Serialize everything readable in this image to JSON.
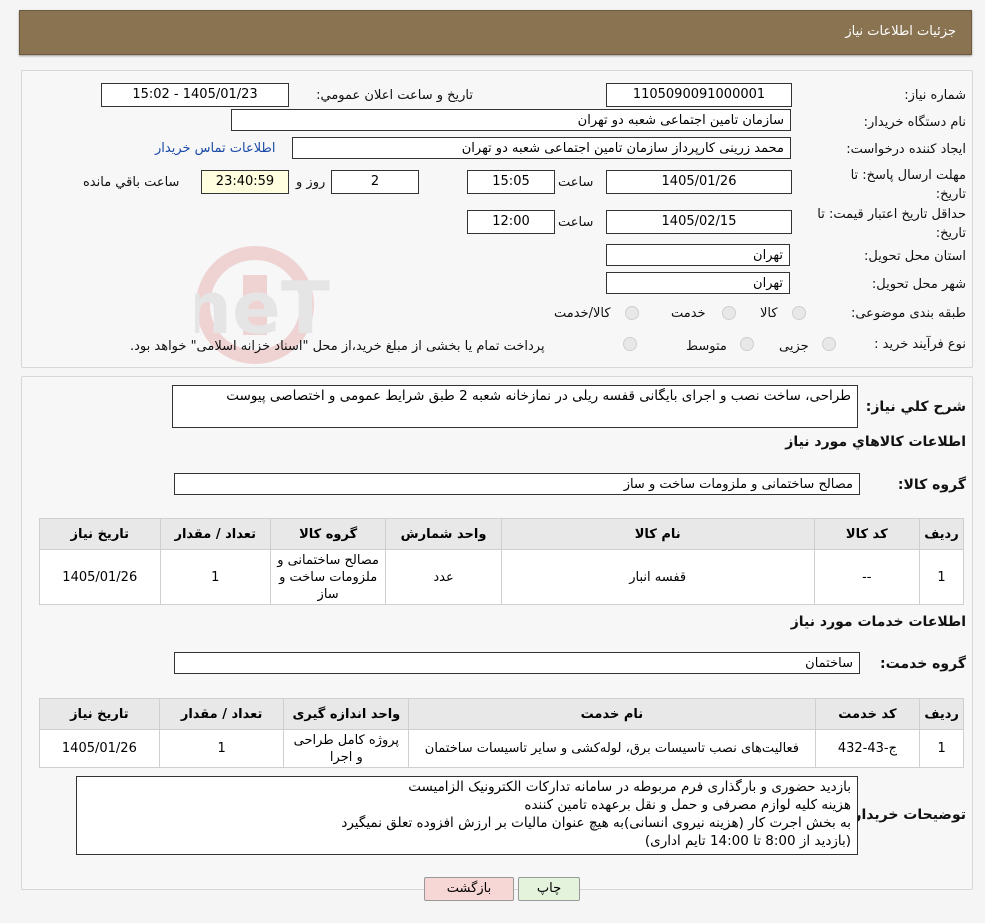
{
  "header": {
    "title": "جزئیات اطلاعات نیاز"
  },
  "info": {
    "need_number_label": "شماره نیاز:",
    "need_number": "1105090091000001",
    "announce_label": "تاریخ و ساعت اعلان عمومي:",
    "announce_value": "1405/01/23 - 15:02",
    "buyer_org_label": "نام دستگاه خریدار:",
    "buyer_org": "سازمان تامین اجتماعی شعبه دو تهران",
    "creator_label": "ایجاد کننده درخواست:",
    "creator": "محمد زرینی کارپرداز سازمان تامین اجتماعی شعبه دو تهران",
    "contact_link": "اطلاعات تماس خریدار",
    "deadline_label": "مهلت ارسال پاسخ: تا تاریخ:",
    "deadline_date": "1405/01/26",
    "time_label": "ساعت",
    "deadline_time": "15:05",
    "days_count": "2",
    "days_label": "روز و",
    "remaining_time": "23:40:59",
    "remaining_label": "ساعت باقي مانده",
    "validity_label": "حداقل تاریخ اعتبار قیمت: تا تاریخ:",
    "validity_date": "1405/02/15",
    "validity_time": "12:00",
    "province_label": "استان محل تحویل:",
    "province": "تهران",
    "city_label": "شهر محل تحویل:",
    "city": "تهران",
    "category_label": "طبقه بندی موضوعی:",
    "cat_options": [
      "کالا",
      "خدمت",
      "کالا/خدمت"
    ],
    "process_label": "نوع فرآیند خرید :",
    "process_options": [
      "جزیی",
      "متوسط"
    ],
    "process_note": "پرداخت تمام یا بخشی از مبلغ خرید،از محل \"اسناد خزانه اسلامی\" خواهد بود."
  },
  "summary": {
    "label": "شرح کلي نیاز:",
    "text": "طراحی، ساخت نصب و اجرای بایگانی قفسه ریلی در نمازخانه شعبه 2 طبق شرایط عمومی و اختصاصی پیوست",
    "goods_title": "اطلاعات کالاهاي مورد نیاز",
    "goods_group_label": "گروه کالا:",
    "goods_group": "مصالح ساختمانی و ملزومات ساخت و ساز"
  },
  "goods_table": {
    "headers": [
      "ردیف",
      "کد کالا",
      "نام کالا",
      "واحد شمارش",
      "گروه کالا",
      "تعداد / مقدار",
      "تاریخ نیاز"
    ],
    "rows": [
      [
        "1",
        "--",
        "قفسه انبار",
        "عدد",
        "مصالح ساختمانی و ملزومات ساخت و ساز",
        "1",
        "1405/01/26"
      ]
    ]
  },
  "services": {
    "title": "اطلاعات خدمات مورد نیاز",
    "group_label": "گروه خدمت:",
    "group": "ساختمان"
  },
  "services_table": {
    "headers": [
      "ردیف",
      "کد خدمت",
      "نام خدمت",
      "واحد اندازه گیری",
      "تعداد / مقدار",
      "تاریخ نیاز"
    ],
    "rows": [
      [
        "1",
        "ج-43-432",
        "فعالیت‌های نصب تاسیسات برق، لوله‌کشی و سایر تاسیسات ساختمان",
        "پروژه کامل طراحی و اجرا",
        "1",
        "1405/01/26"
      ]
    ]
  },
  "buyer_notes": {
    "label": "توضیحات خریدار:",
    "lines": [
      "بازدید حضوری و بارگذاری فرم مربوطه در سامانه تدارکات الکترونیک الزامیست",
      "هزینه کلیه لوازم مصرفی و حمل و نقل برعهده تامین کننده",
      "به بخش اجرت کار (هزینه نیروی انسانی)به هیچ عنوان مالیات بر ارزش افزوده تعلق نمیگیرد",
      "(بازدید از 8:00 تا 14:00 تایم اداری)"
    ]
  },
  "buttons": {
    "print": "چاپ",
    "back": "بازگشت"
  },
  "colors": {
    "header_bg": "#8a7351",
    "link": "#1a4ba8",
    "back_button": "#f7d6d6",
    "print_button": "#e3f3dc"
  }
}
